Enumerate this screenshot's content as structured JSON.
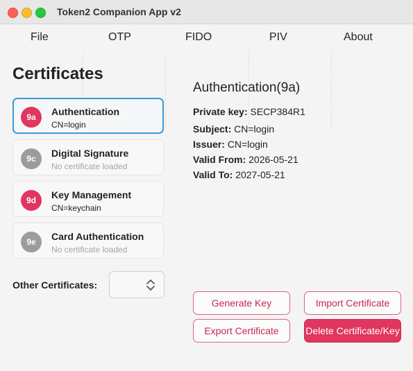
{
  "window": {
    "title": "Token2 Companion App v2"
  },
  "menu": {
    "file": "File",
    "otp": "OTP",
    "fido": "FIDO",
    "piv": "PIV",
    "about": "About"
  },
  "certificates": {
    "heading": "Certificates",
    "slots": [
      {
        "id": "9a",
        "name": "Authentication",
        "subtitle": "CN=login",
        "loaded": true,
        "selected": true
      },
      {
        "id": "9c",
        "name": "Digital Signature",
        "subtitle": "No certificate loaded",
        "loaded": false,
        "selected": false
      },
      {
        "id": "9d",
        "name": "Key Management",
        "subtitle": "CN=keychain",
        "loaded": true,
        "selected": false
      },
      {
        "id": "9e",
        "name": "Card Authentication",
        "subtitle": "No certificate loaded",
        "loaded": false,
        "selected": false
      }
    ],
    "other_label": "Other Certificates:",
    "other_selected": ""
  },
  "details": {
    "title": "Authentication(9a)",
    "private_key_label": "Private key:",
    "private_key_value": "SECP384R1",
    "subject_label": "Subject:",
    "subject_value": "CN=login",
    "issuer_label": "Issuer:",
    "issuer_value": "CN=login",
    "valid_from_label": "Valid From:",
    "valid_from_value": "2026-05-21",
    "valid_to_label": "Valid To:",
    "valid_to_value": "2027-05-21"
  },
  "actions": {
    "generate_key": "Generate Key",
    "import_certificate": "Import Certificate",
    "export_certificate": "Export Certificate",
    "delete_certificate": "Delete Certificate/Key"
  },
  "colors": {
    "accent": "#e0365f",
    "selection_border": "#3a9ad9",
    "inactive_badge": "#9c9c9c"
  }
}
